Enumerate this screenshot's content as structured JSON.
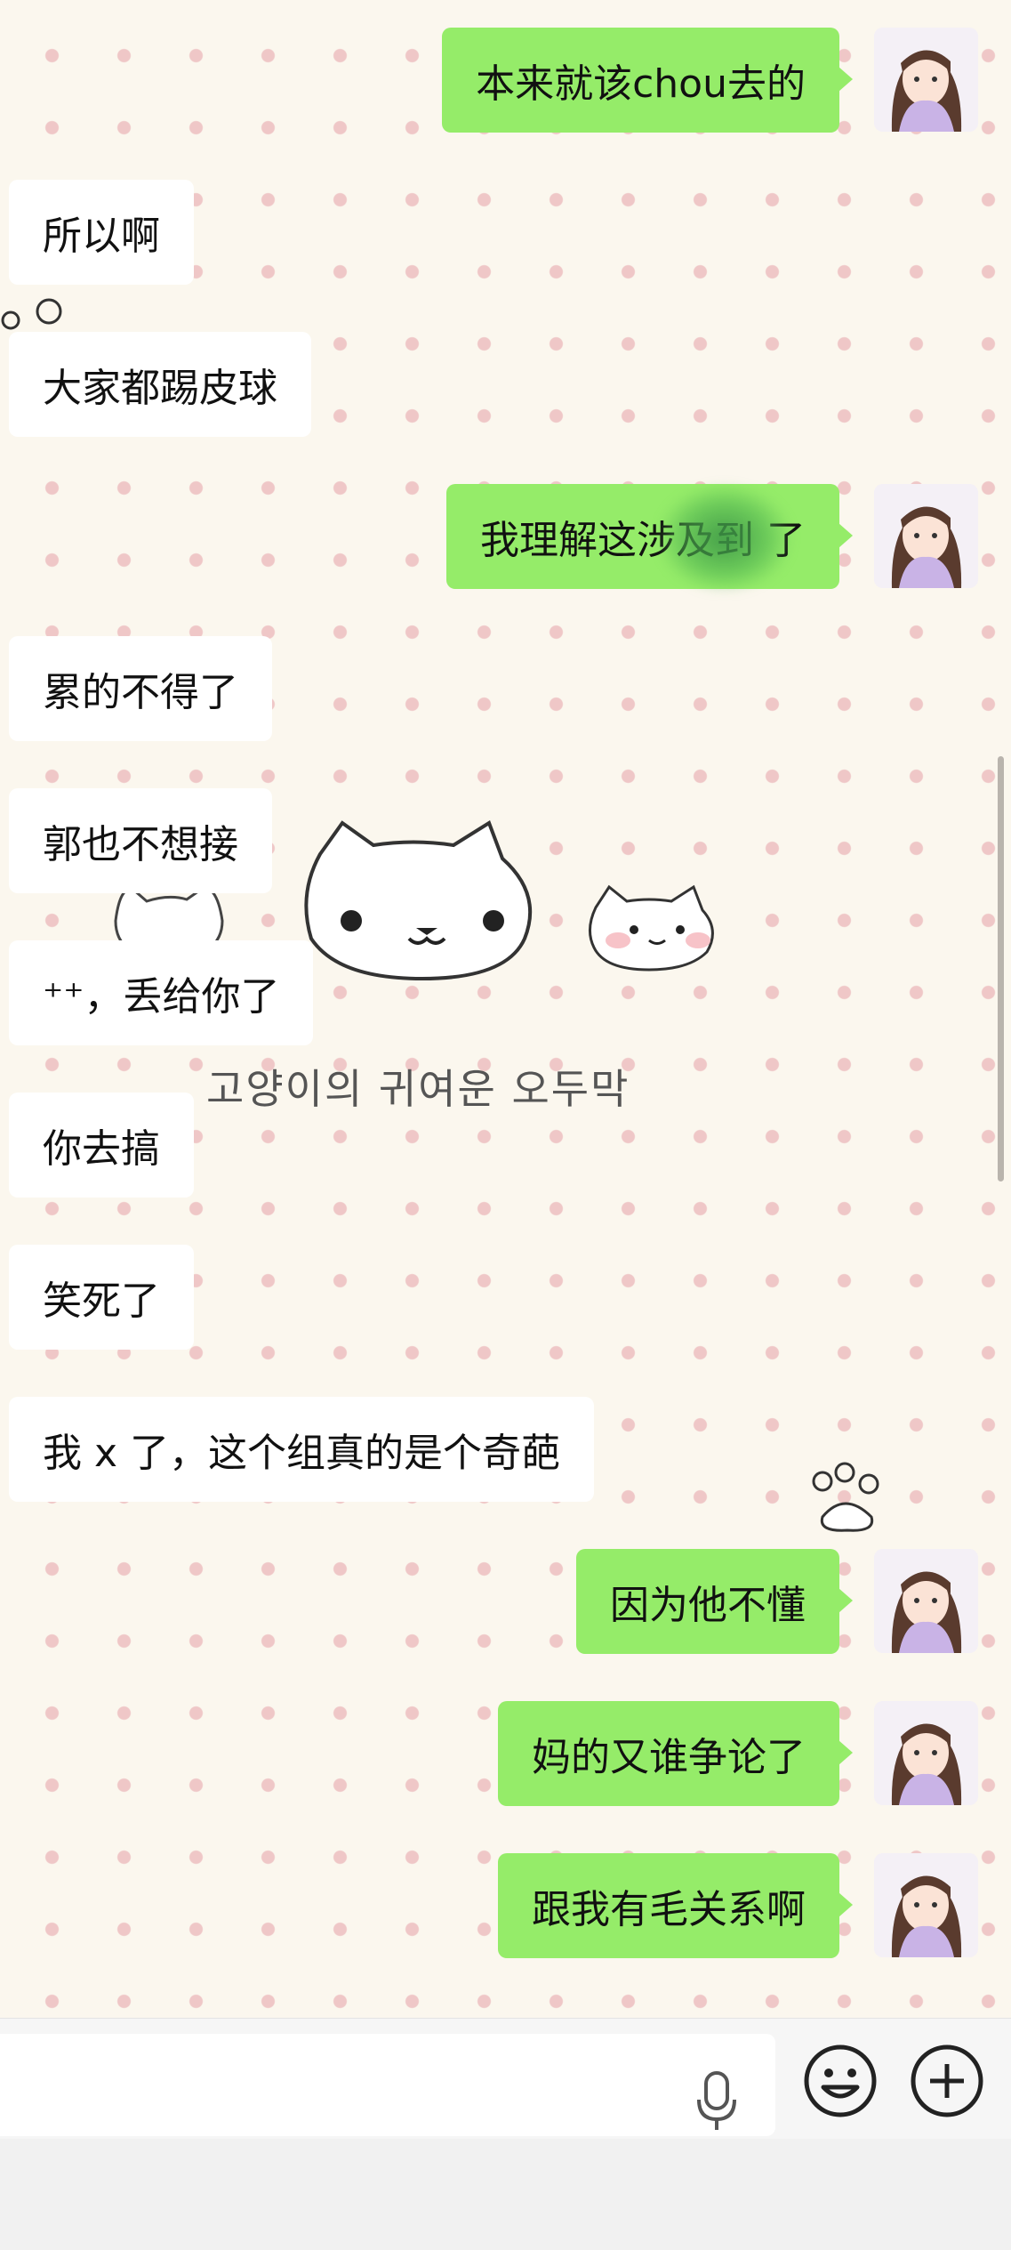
{
  "messages": [
    {
      "side": "out",
      "text": "本来就该chou去的"
    },
    {
      "side": "in",
      "text": "所以啊"
    },
    {
      "side": "in",
      "text": "大家都踢皮球"
    },
    {
      "side": "out",
      "text": "我理解这涉及到 了",
      "note_hidden": true
    },
    {
      "side": "in",
      "text": "累的不得了"
    },
    {
      "side": "in",
      "text": "郭也不想接"
    },
    {
      "side": "in",
      "text": "⁺⁺，丢给你了"
    },
    {
      "side": "in",
      "text": "你去搞"
    },
    {
      "side": "in",
      "text": "笑死了"
    },
    {
      "side": "in",
      "text": "我 x 了，这个组真的是个奇葩"
    },
    {
      "side": "out",
      "text": "因为他不懂"
    },
    {
      "side": "out",
      "text": "妈的又谁争论了"
    },
    {
      "side": "out",
      "text": "跟我有毛关系啊"
    }
  ],
  "wallpaper": {
    "caption": "고양이의 귀여운 오두막",
    "background_color": "#fbf7ee",
    "dot_color": "#efc7c7"
  },
  "input_bar": {
    "icons": [
      "microphone-icon",
      "emoji-icon",
      "plus-icon"
    ]
  },
  "colors": {
    "outgoing_bubble": "#95ec69",
    "incoming_bubble": "#ffffff"
  }
}
